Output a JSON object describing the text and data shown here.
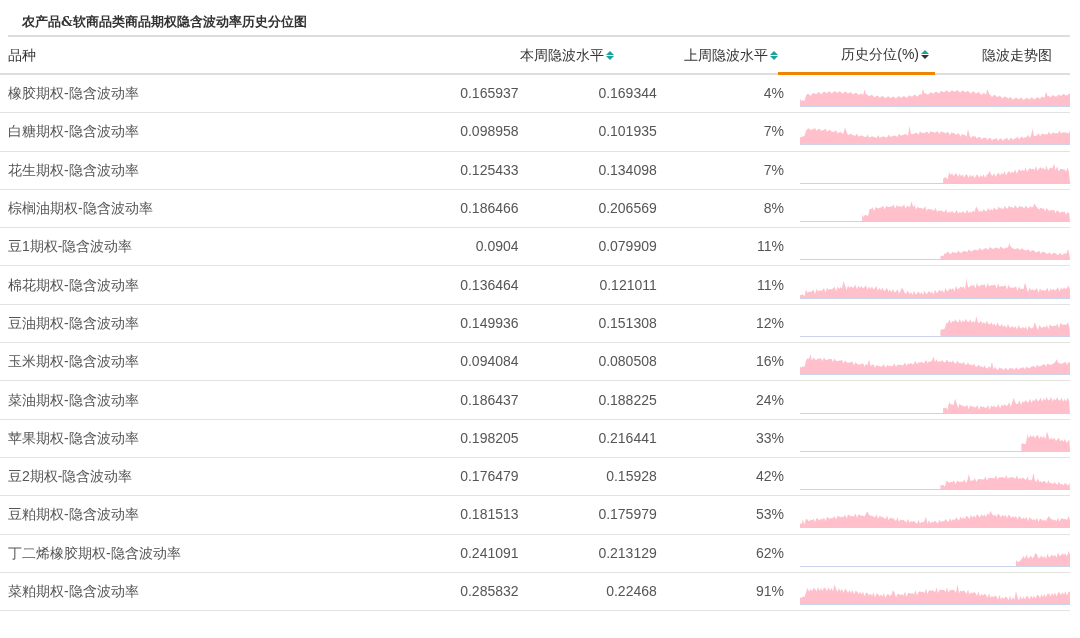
{
  "title": "农产品&软商品类商品期权隐含波动率历史分位图",
  "columns": [
    {
      "label": "品种",
      "sortable": false,
      "sorted": false
    },
    {
      "label": "本周隐波水平",
      "sortable": true,
      "sorted": false
    },
    {
      "label": "上周隐波水平",
      "sortable": true,
      "sorted": false
    },
    {
      "label": "历史分位(%)",
      "sortable": true,
      "sorted": true
    },
    {
      "label": "隐波走势图",
      "sortable": false,
      "sorted": false
    }
  ],
  "rows": [
    {
      "name": "橡胶期权-隐含波动率",
      "this_week": "0.165937",
      "last_week": "0.169344",
      "percentile": "4%"
    },
    {
      "name": "白糖期权-隐含波动率",
      "this_week": "0.098958",
      "last_week": "0.101935",
      "percentile": "7%"
    },
    {
      "name": "花生期权-隐含波动率",
      "this_week": "0.125433",
      "last_week": "0.134098",
      "percentile": "7%"
    },
    {
      "name": "棕榈油期权-隐含波动率",
      "this_week": "0.186466",
      "last_week": "0.206569",
      "percentile": "8%"
    },
    {
      "name": "豆1期权-隐含波动率",
      "this_week": "0.0904",
      "last_week": "0.079909",
      "percentile": "11%"
    },
    {
      "name": "棉花期权-隐含波动率",
      "this_week": "0.136464",
      "last_week": "0.121011",
      "percentile": "11%"
    },
    {
      "name": "豆油期权-隐含波动率",
      "this_week": "0.149936",
      "last_week": "0.151308",
      "percentile": "12%"
    },
    {
      "name": "玉米期权-隐含波动率",
      "this_week": "0.094084",
      "last_week": "0.080508",
      "percentile": "16%"
    },
    {
      "name": "菜油期权-隐含波动率",
      "this_week": "0.186437",
      "last_week": "0.188225",
      "percentile": "24%"
    },
    {
      "name": "苹果期权-隐含波动率",
      "this_week": "0.198205",
      "last_week": "0.216441",
      "percentile": "33%"
    },
    {
      "name": "豆2期权-隐含波动率",
      "this_week": "0.176479",
      "last_week": "0.15928",
      "percentile": "42%"
    },
    {
      "name": "豆粕期权-隐含波动率",
      "this_week": "0.181513",
      "last_week": "0.175979",
      "percentile": "53%"
    },
    {
      "name": "丁二烯橡胶期权-隐含波动率",
      "this_week": "0.241091",
      "last_week": "0.213129",
      "percentile": "62%"
    },
    {
      "name": "菜粕期权-隐含波动率",
      "this_week": "0.285832",
      "last_week": "0.22468",
      "percentile": "91%"
    }
  ]
}
